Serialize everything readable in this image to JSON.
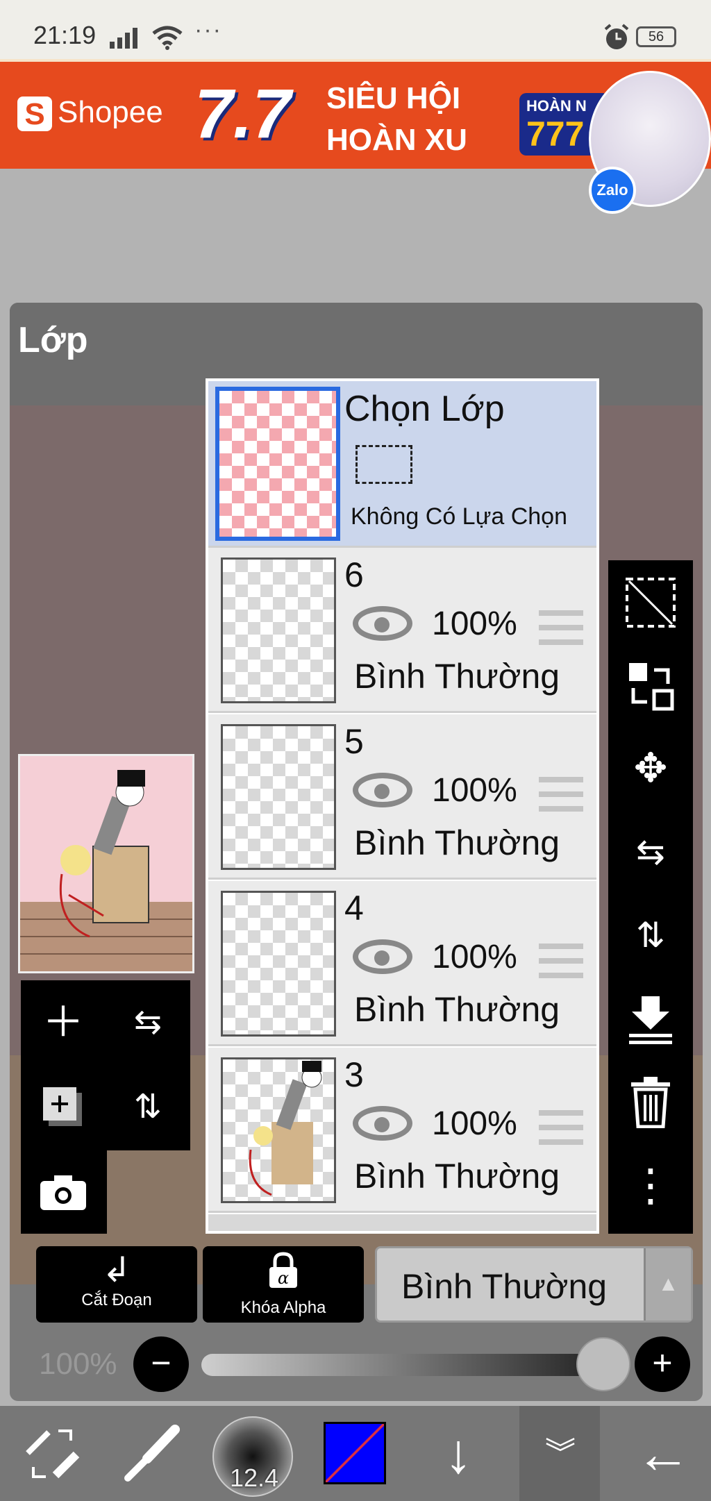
{
  "status_bar": {
    "time": "21:19",
    "dots": "···",
    "battery": "56"
  },
  "ad": {
    "brand": "Shopee",
    "big_number": "7.7",
    "headline_1": "SIÊU HỘI",
    "headline_2": "HOÀN XU",
    "badge_top": "HOÀN N",
    "badge_num": "777",
    "bubble_app": "Zalo"
  },
  "panel": {
    "title": "Lớp"
  },
  "layers": {
    "selection": {
      "title": "Chọn Lớp",
      "status": "Không Có Lựa Chọn"
    },
    "items": [
      {
        "num": "6",
        "opacity": "100%",
        "blend": "Bình Thường"
      },
      {
        "num": "5",
        "opacity": "100%",
        "blend": "Bình Thường"
      },
      {
        "num": "4",
        "opacity": "100%",
        "blend": "Bình Thường"
      },
      {
        "num": "3",
        "opacity": "100%",
        "blend": "Bình Thường"
      }
    ]
  },
  "controls": {
    "clip_label": "Cắt Đoạn",
    "alpha_lock_label": "Khóa Alpha",
    "blend_mode": "Bình Thường",
    "opacity_label": "100%",
    "opacity_value": 1.0
  },
  "bottom": {
    "brush_size": "12.4",
    "color": "#0000ff"
  }
}
